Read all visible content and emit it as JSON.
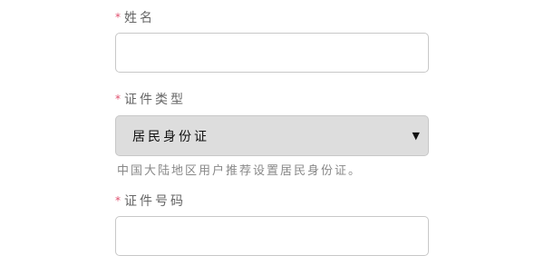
{
  "form": {
    "name_field": {
      "required_mark": "*",
      "label": "姓名",
      "value": "",
      "placeholder": ""
    },
    "id_type_field": {
      "required_mark": "*",
      "label": "证件类型",
      "selected": "居民身份证",
      "caret_icon": "caret-down-icon",
      "help": "中国大陆地区用户推荐设置居民身份证。"
    },
    "id_number_field": {
      "required_mark": "*",
      "label": "证件号码",
      "value": "",
      "placeholder": ""
    }
  },
  "colors": {
    "required": "#e0506e",
    "label": "#666666",
    "input_border": "#c8c8c8",
    "select_bg": "#dddddd",
    "help_text": "#888888"
  }
}
